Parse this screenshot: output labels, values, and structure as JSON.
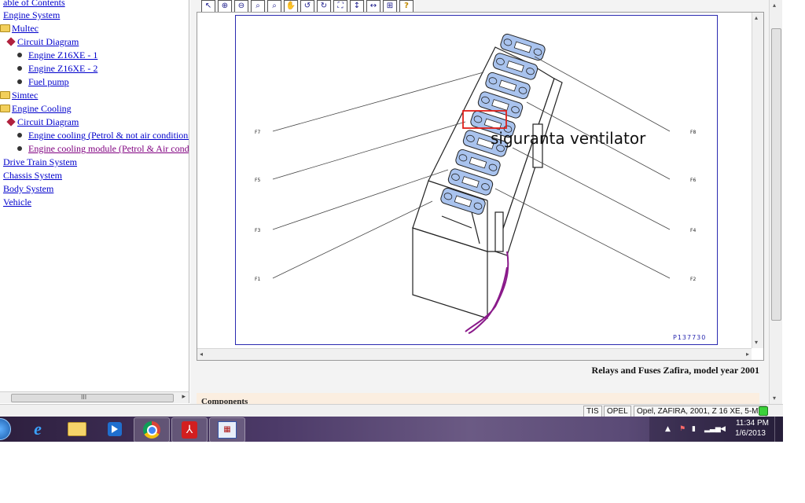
{
  "tree": {
    "items": [
      {
        "label": "able of Contents",
        "level": 0,
        "icon": "none",
        "visited": false
      },
      {
        "label": "Engine System",
        "level": 0,
        "icon": "none",
        "visited": false
      },
      {
        "label": "Multec",
        "level": 1,
        "icon": "folder-icon",
        "visited": false
      },
      {
        "label": "Circuit Diagram",
        "level": 1,
        "icon": "circuit-diagram-icon",
        "visited": false
      },
      {
        "label": "Engine Z16XE - 1",
        "level": 2,
        "icon": "bullet-icon",
        "visited": false
      },
      {
        "label": "Engine Z16XE - 2",
        "level": 2,
        "icon": "bullet-icon",
        "visited": false
      },
      {
        "label": "Fuel pump",
        "level": 2,
        "icon": "bullet-icon",
        "visited": false
      },
      {
        "label": "Simtec",
        "level": 1,
        "icon": "folder-icon",
        "visited": false
      },
      {
        "label": "Engine Cooling",
        "level": 1,
        "icon": "folder-icon",
        "visited": false
      },
      {
        "label": "Circuit Diagram",
        "level": 1,
        "icon": "circuit-diagram-icon",
        "visited": false
      },
      {
        "label": "Engine cooling (Petrol & not air conditioni",
        "level": 2,
        "icon": "bullet-icon",
        "visited": false
      },
      {
        "label": "Engine cooling module (Petrol & Air cond",
        "level": 2,
        "icon": "bullet-icon",
        "visited": true
      },
      {
        "label": "Drive Train System",
        "level": 0,
        "icon": "none",
        "visited": false
      },
      {
        "label": "Chassis System",
        "level": 0,
        "icon": "none",
        "visited": false
      },
      {
        "label": "Body System",
        "level": 0,
        "icon": "none",
        "visited": false
      },
      {
        "label": "Vehicle",
        "level": 0,
        "icon": "none",
        "visited": false
      }
    ],
    "scroll_grip": "III"
  },
  "toolbar": {
    "buttons": [
      {
        "name": "select-arrow-icon",
        "glyph": "↖"
      },
      {
        "name": "zoom-in-icon",
        "glyph": "⊕"
      },
      {
        "name": "zoom-out-icon",
        "glyph": "⊖"
      },
      {
        "name": "zoom-icon",
        "glyph": "⌕"
      },
      {
        "name": "zoom-window-icon",
        "glyph": "⌕"
      },
      {
        "name": "pan-hand-icon",
        "glyph": "✋"
      },
      {
        "name": "rotate-left-icon",
        "glyph": "↺"
      },
      {
        "name": "rotate-right-icon",
        "glyph": "↻"
      },
      {
        "name": "fit-page-icon",
        "glyph": "⛶"
      },
      {
        "name": "fit-height-icon",
        "glyph": "↕"
      },
      {
        "name": "fit-width-icon",
        "glyph": "↔"
      },
      {
        "name": "measure-icon",
        "glyph": "⊞"
      },
      {
        "name": "help-icon",
        "glyph": "?"
      }
    ]
  },
  "diagram": {
    "labels_left": [
      "F7",
      "F5",
      "F3",
      "F1"
    ],
    "labels_right": [
      "F8",
      "F6",
      "F4",
      "F2"
    ],
    "annotation": "siguranta ventilator",
    "code": "P137730",
    "colors": {
      "frame": "#2a2ab0",
      "fuse_fill": "#a9c3ee",
      "highlight": "#e0201a",
      "scribble": "#8a1a8a"
    }
  },
  "caption": "Relays and Fuses Zafira, model year 2001",
  "components_heading": "Components",
  "status": {
    "cells": [
      "TIS",
      "OPEL",
      "Opel, ZAFIRA, 2001, Z 16 XE, 5-MT"
    ],
    "led_color": "#3bd13b"
  },
  "taskbar": {
    "apps": [
      {
        "name": "start-orb-icon"
      },
      {
        "name": "internet-explorer-icon"
      },
      {
        "name": "file-explorer-icon"
      },
      {
        "name": "media-player-icon"
      },
      {
        "name": "chrome-icon"
      },
      {
        "name": "acrobat-reader-icon"
      },
      {
        "name": "tis-app-icon"
      }
    ],
    "clock_time": "11:34 PM",
    "clock_date": "1/6/2013"
  }
}
